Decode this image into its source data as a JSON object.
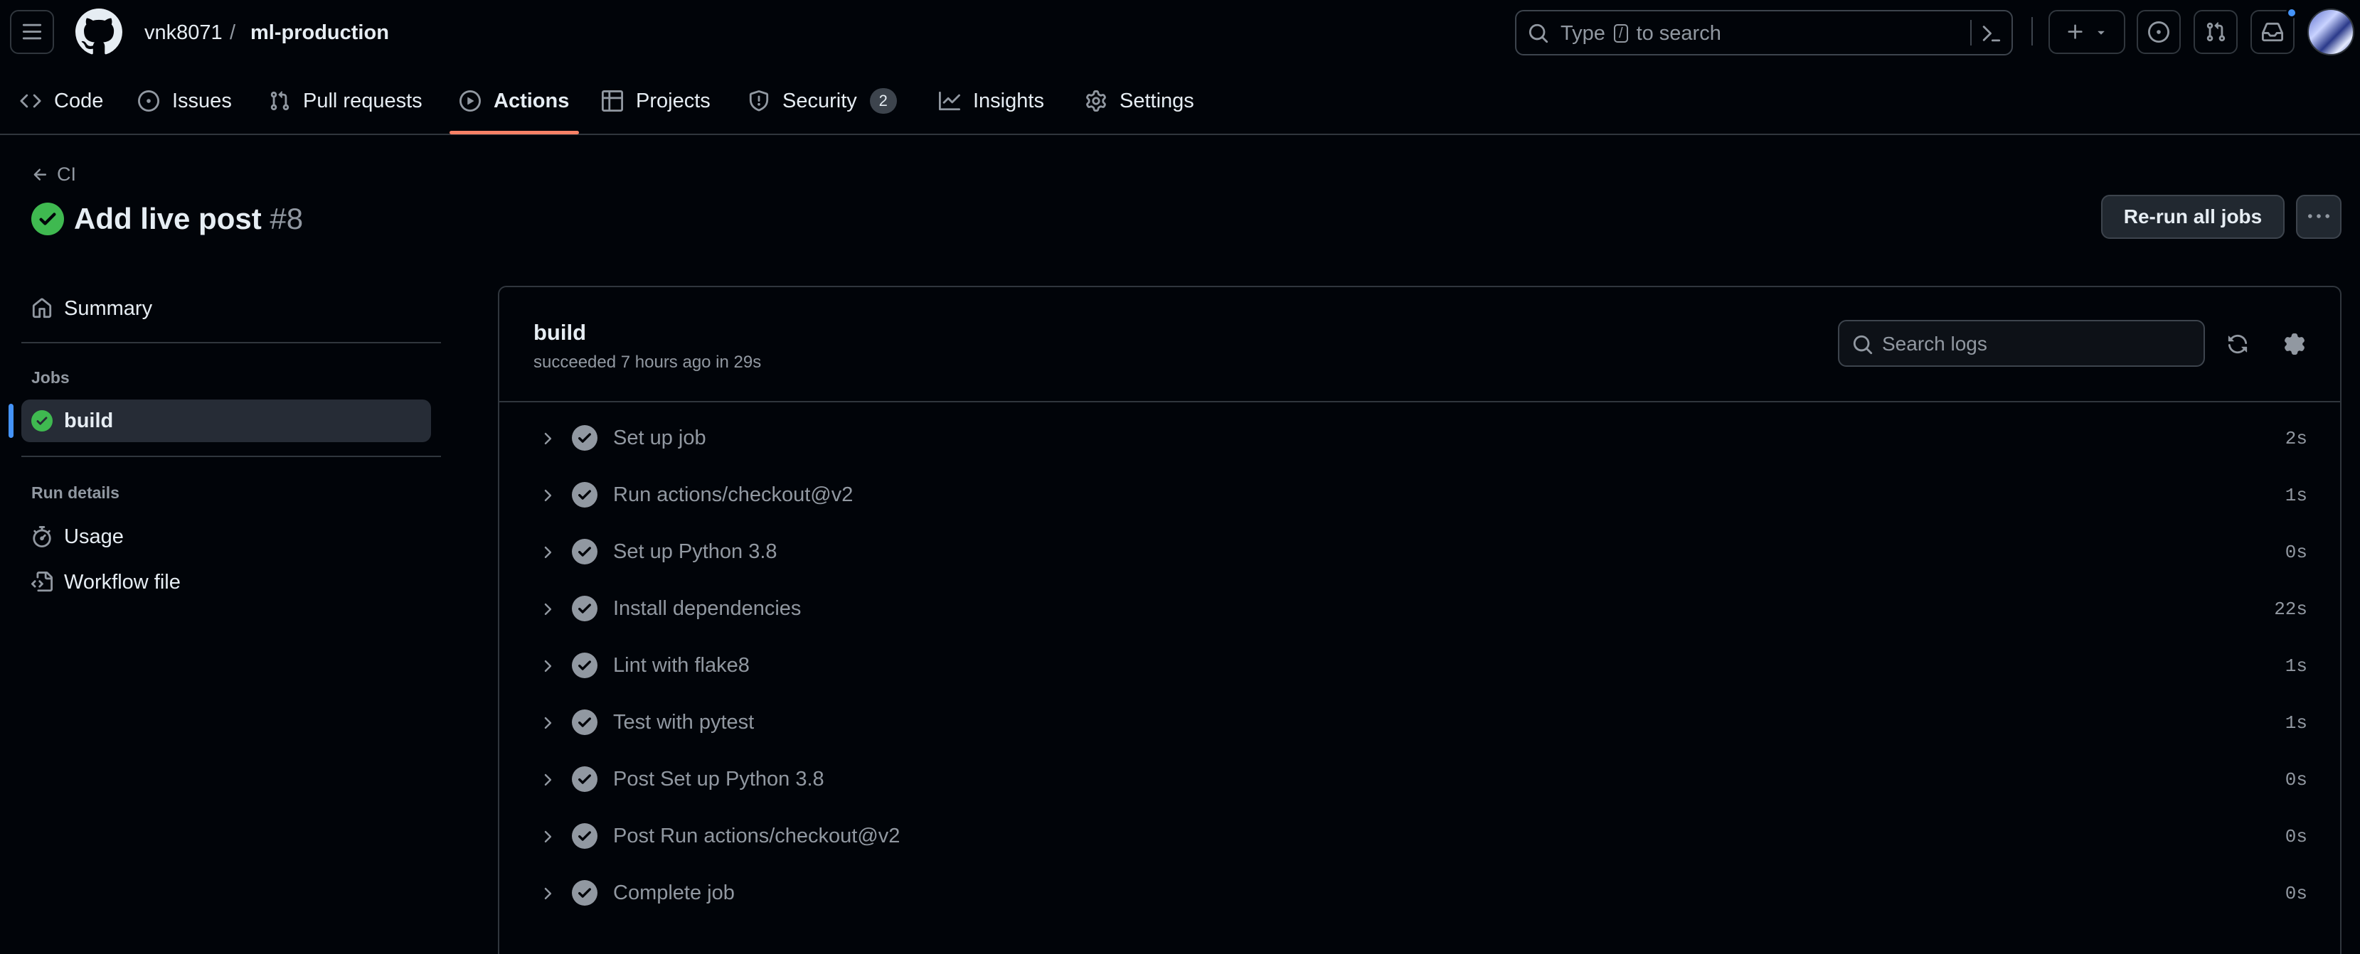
{
  "header": {
    "owner": "vnk8071",
    "separator": "/",
    "repo": "ml-production",
    "search": {
      "prefix": "Type",
      "key": "/",
      "suffix": "to search"
    }
  },
  "tabs": [
    {
      "label": "Code",
      "icon": "code-icon"
    },
    {
      "label": "Issues",
      "icon": "issue-icon"
    },
    {
      "label": "Pull requests",
      "icon": "pull-request-icon"
    },
    {
      "label": "Actions",
      "icon": "play-icon",
      "selected": true
    },
    {
      "label": "Projects",
      "icon": "table-icon"
    },
    {
      "label": "Security",
      "icon": "shield-icon",
      "count": "2"
    },
    {
      "label": "Insights",
      "icon": "graph-icon"
    },
    {
      "label": "Settings",
      "icon": "gear-icon"
    }
  ],
  "run": {
    "back_label": "CI",
    "title": "Add live post",
    "number": "#8",
    "rerun_label": "Re-run all jobs"
  },
  "sidebar": {
    "summary_label": "Summary",
    "jobs_heading": "Jobs",
    "jobs": [
      {
        "label": "build",
        "status": "success"
      }
    ],
    "run_details_heading": "Run details",
    "usage_label": "Usage",
    "workflow_label": "Workflow file"
  },
  "job": {
    "name": "build",
    "status_text": "succeeded 7 hours ago in 29s",
    "search_placeholder": "Search logs",
    "steps": [
      {
        "label": "Set up job",
        "duration": "2s"
      },
      {
        "label": "Run actions/checkout@v2",
        "duration": "1s"
      },
      {
        "label": "Set up Python 3.8",
        "duration": "0s"
      },
      {
        "label": "Install dependencies",
        "duration": "22s"
      },
      {
        "label": "Lint with flake8",
        "duration": "1s"
      },
      {
        "label": "Test with pytest",
        "duration": "1s"
      },
      {
        "label": "Post Set up Python 3.8",
        "duration": "0s"
      },
      {
        "label": "Post Run actions/checkout@v2",
        "duration": "0s"
      },
      {
        "label": "Complete job",
        "duration": "0s"
      }
    ]
  },
  "colors": {
    "success": "#3fb950",
    "accent_underline": "#f78166",
    "active_bar": "#4493f8",
    "background": "#010409"
  }
}
